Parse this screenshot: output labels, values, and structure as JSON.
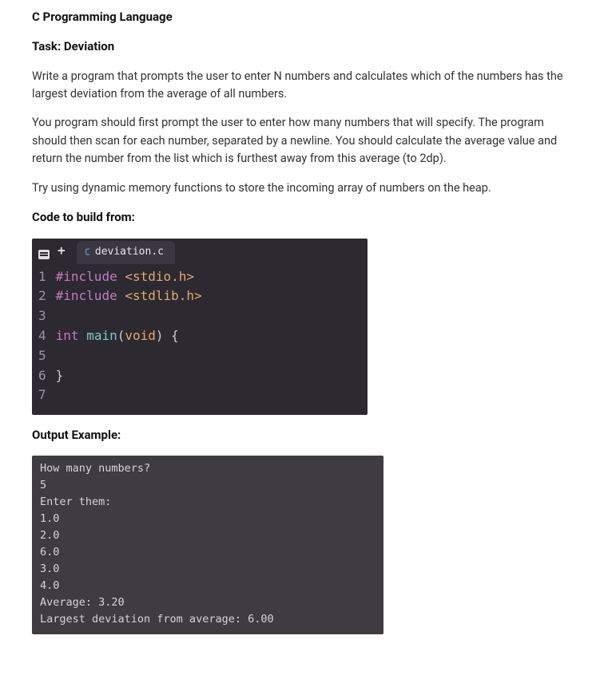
{
  "heading": "C Programming Language",
  "task_label": "Task: Deviation",
  "para1": "Write a program that prompts the user to enter N numbers and calculates which of the numbers has the largest deviation from the average of all numbers.",
  "para2": "You program should first prompt the user to enter how many numbers that will specify. The program should then scan for each number, separated by a newline. You should calculate the average value and return the number from the list which is furthest away from this average (to 2dp).",
  "para3": "Try using dynamic memory functions to store the incoming array of numbers on the heap.",
  "code_label": "Code to build from:",
  "editor": {
    "tab_lang": "C",
    "tab_name": "deviation.c",
    "lines": {
      "l1": "1",
      "l2": "2",
      "l3": "3",
      "l4": "4",
      "l5": "5",
      "l6": "6",
      "l7": "7"
    },
    "code": {
      "inc1_kw": "#include",
      "inc1_hdr": "<stdio.h>",
      "inc2_kw": "#include",
      "inc2_hdr": "<stdlib.h>",
      "int_kw": "int",
      "main_fn": "main",
      "void_kw": "void",
      "open": "(",
      "close": ")",
      "brace_o": "{",
      "brace_c": "}"
    }
  },
  "output_label": "Output Example:",
  "terminal": {
    "t1": "How many numbers?",
    "t2": "5",
    "t3": "Enter them:",
    "t4": "1.0",
    "t5": "2.0",
    "t6": "6.0",
    "t7": "3.0",
    "t8": "4.0",
    "t9": "Average: 3.20",
    "t10": "Largest deviation from average: 6.00"
  }
}
